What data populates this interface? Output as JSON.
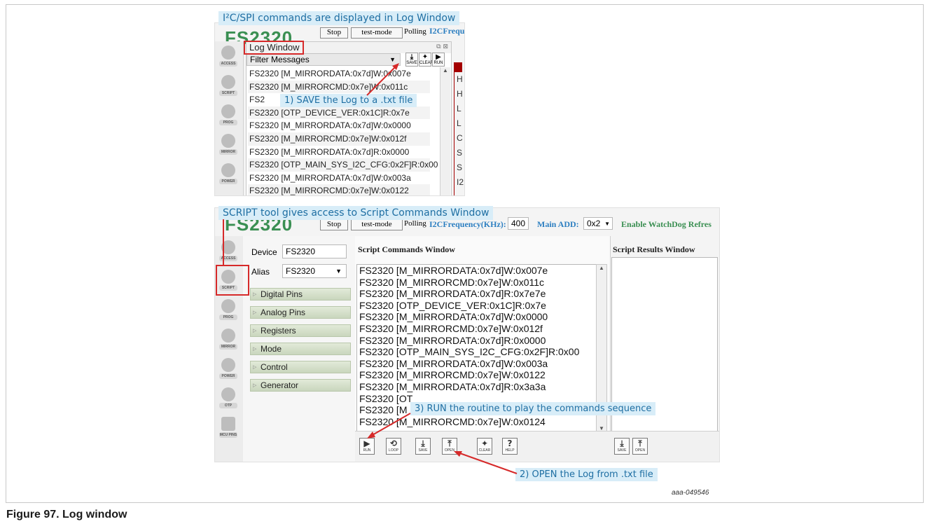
{
  "figure": {
    "caption": "Figure 97.  Log window",
    "figure_id": "aaa-049546"
  },
  "callouts": {
    "i2c_spi": "I²C/SPI commands are displayed in Log Window",
    "save": "1) SAVE the Log to a .txt file",
    "script_tool": "SCRIPT tool gives access to Script Commands Window",
    "run": "3) RUN the routine to play the commands sequence",
    "open": "2) OPEN the Log from .txt file"
  },
  "app": {
    "brand": "FS2320",
    "stop_label": "Stop",
    "mode_label": "test-mode",
    "polling_label": "Polling",
    "i2c_freq_label": "I2CFrequency",
    "i2c_freq_label_full": "I2CFrequency(KHz):",
    "i2c_freq_value": "400",
    "main_add_label": "Main ADD:",
    "main_add_value": "0x2",
    "watchdog_label": "Enable WatchDog Refres"
  },
  "sidebar": {
    "items": [
      {
        "label": "ACCESS",
        "icon": "chip-icon"
      },
      {
        "label": "SCRIPT",
        "icon": "code-icon"
      },
      {
        "label": "PROG",
        "icon": "gear-icon"
      },
      {
        "label": "MIRROR",
        "icon": "mirror-icon"
      },
      {
        "label": "POWER",
        "icon": "calculator-icon"
      },
      {
        "label": "OTP",
        "icon": "arrow-icon"
      },
      {
        "label": "MCU PINS",
        "icon": "pins-icon"
      }
    ]
  },
  "log_window": {
    "title": "Log Window",
    "filter": "Filter Messages",
    "buttons": {
      "save": "SAVE",
      "clear": "CLEAR",
      "run": "RUN"
    },
    "side_letters": [
      "H",
      "H",
      "L",
      "L",
      "C",
      "S",
      "S",
      "I2"
    ],
    "lines": [
      "FS2320 [M_MIRRORDATA:0x7d]W:0x007e",
      "FS2320 [M_MIRRORCMD:0x7e]W:0x011c",
      "FS2",
      "FS2320 [OTP_DEVICE_VER:0x1C]R:0x7e",
      "FS2320 [M_MIRRORDATA:0x7d]W:0x0000",
      "FS2320 [M_MIRRORCMD:0x7e]W:0x012f",
      "FS2320 [M_MIRRORDATA:0x7d]R:0x0000",
      "FS2320 [OTP_MAIN_SYS_I2C_CFG:0x2F]R:0x00",
      "FS2320 [M_MIRRORDATA:0x7d]W:0x003a",
      "FS2320 [M_MIRRORCMD:0x7e]W:0x0122"
    ]
  },
  "script_window": {
    "device_label": "Device",
    "device_value": "FS2320",
    "alias_label": "Alias",
    "alias_value": "FS2320",
    "nav": [
      "Digital Pins",
      "Analog Pins",
      "Registers",
      "Mode",
      "Control",
      "Generator"
    ],
    "commands_title": "Script Commands Window",
    "results_title": "Script Results Window",
    "commands": [
      "FS2320 [M_MIRRORDATA:0x7d]W:0x007e",
      "FS2320 [M_MIRRORCMD:0x7e]W:0x011c",
      "FS2320 [M_MIRRORDATA:0x7d]R:0x7e7e",
      "FS2320 [OTP_DEVICE_VER:0x1C]R:0x7e",
      "FS2320 [M_MIRRORDATA:0x7d]W:0x0000",
      "FS2320 [M_MIRRORCMD:0x7e]W:0x012f",
      "FS2320 [M_MIRRORDATA:0x7d]R:0x0000",
      "FS2320 [OTP_MAIN_SYS_I2C_CFG:0x2F]R:0x00",
      "FS2320 [M_MIRRORDATA:0x7d]W:0x003a",
      "FS2320 [M_MIRRORCMD:0x7e]W:0x0122",
      "FS2320 [M_MIRRORDATA:0x7d]R:0x3a3a",
      "FS2320 [OT",
      "FS2320 [M",
      "FS2320 [M_MIRRORCMD:0x7e]W:0x0124"
    ],
    "buttons": {
      "run": "RUN",
      "loop": "LOOP",
      "save": "SAVE",
      "open": "OPEN",
      "clear": "CLEAR",
      "help": "HELP"
    },
    "result_buttons": {
      "save": "SAVE",
      "open": "OPEN"
    }
  }
}
